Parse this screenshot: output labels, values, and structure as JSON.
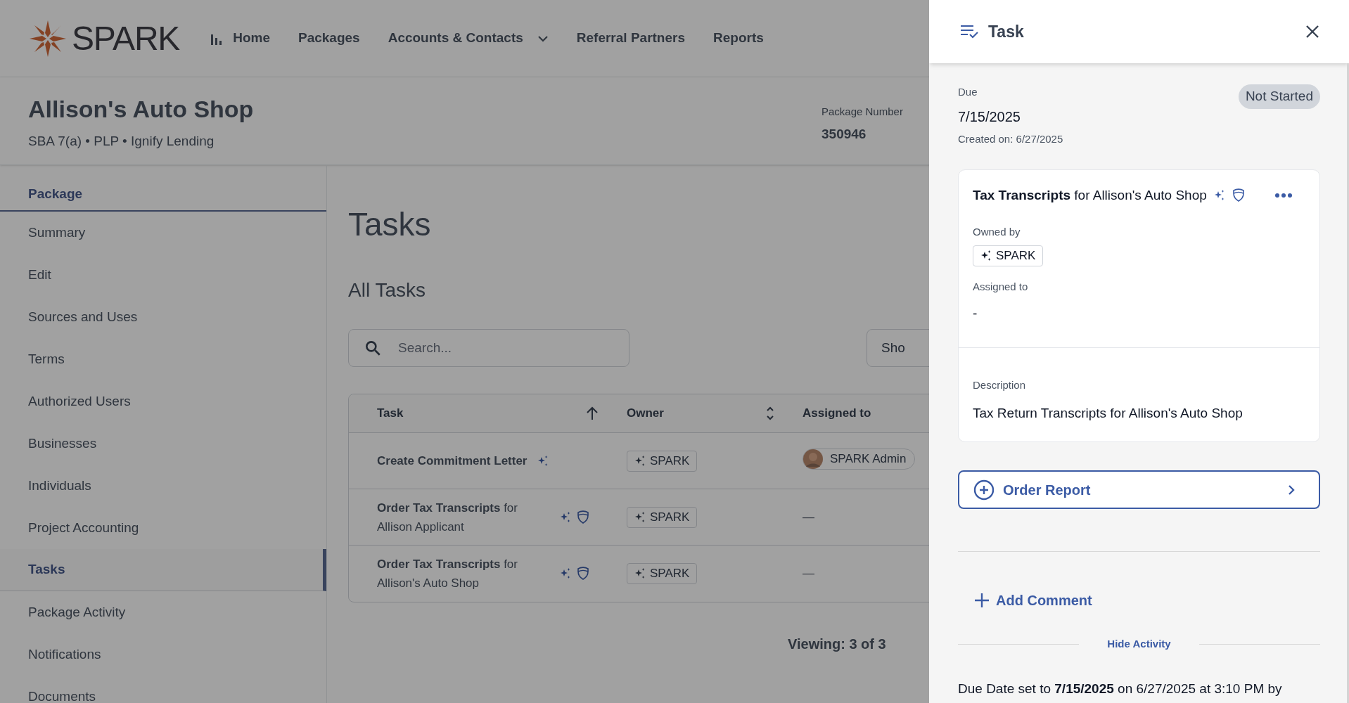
{
  "brand": {
    "name": "SPARK"
  },
  "nav": [
    {
      "label": "Home",
      "dropdown": false
    },
    {
      "label": "Packages",
      "dropdown": false
    },
    {
      "label": "Accounts & Contacts",
      "dropdown": true
    },
    {
      "label": "Referral Partners",
      "dropdown": false
    },
    {
      "label": "Reports",
      "dropdown": false
    }
  ],
  "package": {
    "title": "Allison's Auto Shop",
    "subtitle": "SBA 7(a) • PLP • Ignify Lending",
    "number_label": "Package Number",
    "number": "350946"
  },
  "sidebar": {
    "heading": "Package",
    "items": [
      {
        "label": "Summary",
        "selected": false
      },
      {
        "label": "Edit",
        "selected": false
      },
      {
        "label": "Sources and Uses",
        "selected": false
      },
      {
        "label": "Terms",
        "selected": false
      },
      {
        "label": "Authorized Users",
        "selected": false
      },
      {
        "label": "Businesses",
        "selected": false
      },
      {
        "label": "Individuals",
        "selected": false
      },
      {
        "label": "Project Accounting",
        "selected": false
      },
      {
        "label": "Tasks",
        "selected": true
      },
      {
        "label": "Package Activity",
        "selected": false
      },
      {
        "label": "Notifications",
        "selected": false
      },
      {
        "label": "Documents",
        "selected": false
      }
    ]
  },
  "main": {
    "title": "Tasks",
    "section": "All Tasks",
    "search": {
      "placeholder": "Search..."
    },
    "show_button": "Sho",
    "table": {
      "columns": [
        {
          "label": "Task",
          "sorted": true
        },
        {
          "label": "Owner",
          "sorted": false
        },
        {
          "label": "Assigned to"
        }
      ],
      "rows": [
        {
          "task": "**Create Commitment Letter**",
          "ai": true,
          "shield": false,
          "owner": "SPARK",
          "assignee": "SPARK Admin"
        },
        {
          "task": "**Order Tax Transcripts** for Allison Applicant",
          "ai": true,
          "shield": true,
          "owner": "SPARK",
          "assignee": "—"
        },
        {
          "task": "**Order Tax Transcripts** for Allison's Auto Shop",
          "ai": true,
          "shield": true,
          "owner": "SPARK",
          "assignee": "—"
        }
      ]
    },
    "viewing": "Viewing: 3 of 3"
  },
  "panel": {
    "title": "Task",
    "due_label": "Due",
    "due": "7/15/2025",
    "created": "Created on: 6/27/2025",
    "status": "Not Started",
    "card": {
      "title": "**Tax Transcripts** for Allison's Auto Shop",
      "ai": true,
      "shield": true,
      "owned_label": "Owned by",
      "owner": "SPARK",
      "assigned_label": "Assigned to",
      "assigned": "-",
      "description_label": "Description",
      "description": "Tax Return Transcripts for Allison's Auto Shop"
    },
    "order_button": "Order Report",
    "add_comment": "Add Comment",
    "hide_activity": "Hide Activity",
    "activity": [
      "Due Date set to **7/15/2025** on 6/27/2025 at 3:10 PM by"
    ]
  }
}
